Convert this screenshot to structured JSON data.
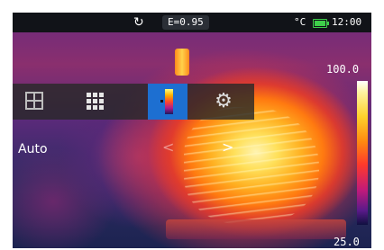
{
  "status_bar": {
    "refresh_icon": "refresh-icon",
    "emissivity": "E=0.95",
    "unit": "°C",
    "battery_icon": "battery-icon",
    "time": "12:00"
  },
  "menu": {
    "items": [
      {
        "icon": "split-view-icon",
        "active": false
      },
      {
        "icon": "grid-icon",
        "active": false
      },
      {
        "icon": "color-palette-icon",
        "active": true
      },
      {
        "icon": "settings-gear-icon",
        "active": false
      }
    ]
  },
  "option": {
    "label": "Auto",
    "prev_arrow": "<",
    "next_arrow": ">"
  },
  "temperature_scale": {
    "max": "100.0",
    "min": "25.0"
  },
  "colors": {
    "active_menu": "#1d6fd1",
    "battery": "#3ecf4a"
  }
}
